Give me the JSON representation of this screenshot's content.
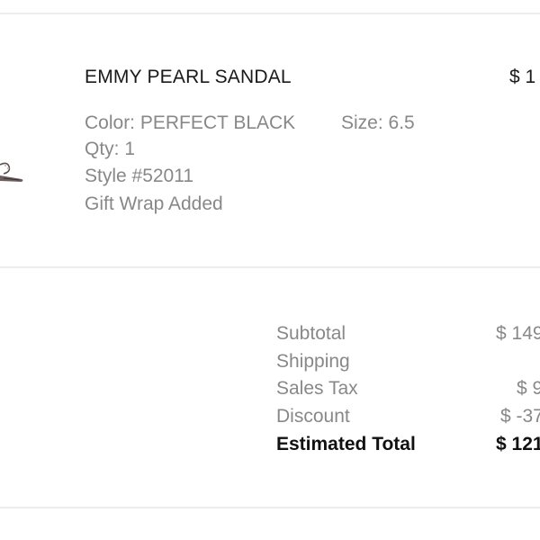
{
  "item": {
    "name": "EMMY PEARL SANDAL",
    "price": "$ 1",
    "color": "Color: PERFECT BLACK",
    "size": "Size: 6.5",
    "qty": "Qty: 1",
    "style": "Style #52011",
    "gift_wrap": "Gift Wrap Added",
    "thumbnail_icon": "sandal-thumbnail"
  },
  "summary": {
    "rows": [
      {
        "label": "Subtotal",
        "value": "$ 149"
      },
      {
        "label": "Shipping",
        "value": ""
      },
      {
        "label": "Sales Tax",
        "value": "$ 9"
      },
      {
        "label": "Discount",
        "value": "$ -37"
      },
      {
        "label": "Estimated Total",
        "value": "$ 121"
      }
    ]
  },
  "colors": {
    "primary_text": "#1a1a1a",
    "secondary_text": "#888888",
    "divider": "#ececec"
  }
}
